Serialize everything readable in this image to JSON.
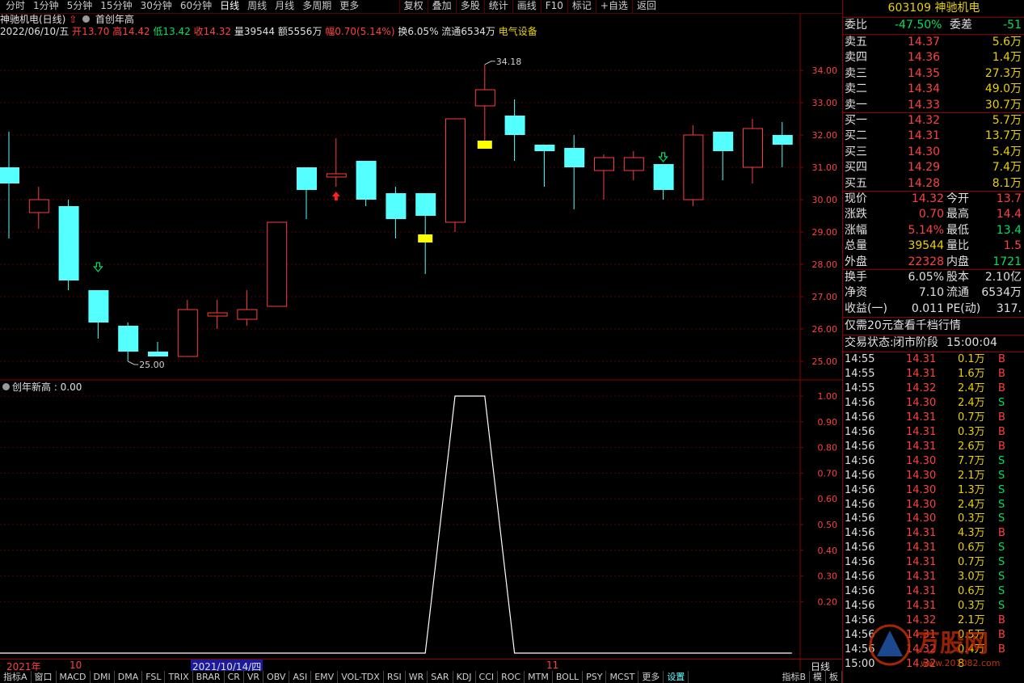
{
  "toolbar": {
    "periods": [
      "分时",
      "1分钟",
      "5分钟",
      "15分钟",
      "30分钟",
      "60分钟",
      "日线",
      "周线",
      "月线",
      "多周期",
      "更多"
    ],
    "active_period": "日线",
    "right_buttons": [
      "复权",
      "叠加",
      "多股",
      "统计",
      "画线",
      "F10",
      "标记",
      "+自选",
      "返回"
    ]
  },
  "header": {
    "title": "神驰机电(日线)",
    "indicator_name": "首创年高",
    "date": "2022/06/10/五",
    "open_label": "开",
    "open": "13.70",
    "high_label": "高",
    "high": "14.42",
    "low_label": "低",
    "low": "13.42",
    "close_label": "收",
    "close": "14.32",
    "vol_label": "量",
    "vol": "39544",
    "amount_label": "额",
    "amount": "5556万",
    "range_label": "幅",
    "range": "0.70(5.14%)",
    "turnover_label": "换",
    "turnover": "6.05%",
    "float_label": "流通",
    "float": "6534万",
    "sector": "电气设备"
  },
  "lower_header": {
    "label": "创年新高 : 0.00"
  },
  "colors": {
    "up": "#ff3c3c",
    "down": "#54ffff",
    "grid": "#5a0000",
    "axis": "#8a0000",
    "signal": "#ffff00",
    "marker_up": "#ff2020",
    "marker_down": "#00e060"
  },
  "chart_data": [
    {
      "type": "candlestick",
      "title": "神驰机电(日线)",
      "ylim": [
        24.5,
        35.0
      ],
      "y_ticks": [
        "34.00",
        "33.00",
        "32.00",
        "31.00",
        "30.00",
        "29.00",
        "28.00",
        "27.00",
        "26.00",
        "25.00"
      ],
      "y_tick_values": [
        34,
        33,
        32,
        31,
        30,
        29,
        28,
        27,
        26,
        25
      ],
      "annotations": {
        "max_label": "34.18",
        "min_label": "25.00"
      },
      "candles": [
        {
          "o": 31.0,
          "h": 32.1,
          "l": 28.8,
          "c": 30.5
        },
        {
          "o": 29.6,
          "h": 30.4,
          "l": 29.1,
          "c": 30.0
        },
        {
          "o": 29.8,
          "h": 30.0,
          "l": 27.2,
          "c": 27.5
        },
        {
          "o": 27.2,
          "h": 27.2,
          "l": 25.7,
          "c": 26.2
        },
        {
          "o": 26.1,
          "h": 26.2,
          "l": 25.0,
          "c": 25.3
        },
        {
          "o": 25.3,
          "h": 25.6,
          "l": 25.15,
          "c": 25.15
        },
        {
          "o": 25.15,
          "h": 26.9,
          "l": 25.15,
          "c": 26.6
        },
        {
          "o": 26.4,
          "h": 26.9,
          "l": 26.0,
          "c": 26.5
        },
        {
          "o": 26.3,
          "h": 27.2,
          "l": 26.1,
          "c": 26.6
        },
        {
          "o": 26.7,
          "h": 29.3,
          "l": 26.7,
          "c": 29.3
        },
        {
          "o": 31.0,
          "h": 31.0,
          "l": 29.4,
          "c": 30.3
        },
        {
          "o": 30.7,
          "h": 31.9,
          "l": 30.4,
          "c": 30.8
        },
        {
          "o": 31.2,
          "h": 31.2,
          "l": 29.8,
          "c": 30.0
        },
        {
          "o": 30.2,
          "h": 30.4,
          "l": 28.8,
          "c": 29.4
        },
        {
          "o": 30.2,
          "h": 30.2,
          "l": 27.7,
          "c": 29.5
        },
        {
          "o": 29.3,
          "h": 32.5,
          "l": 29.0,
          "c": 32.5
        },
        {
          "o": 32.9,
          "h": 34.18,
          "l": 31.8,
          "c": 33.4
        },
        {
          "o": 32.6,
          "h": 33.1,
          "l": 31.2,
          "c": 32.0
        },
        {
          "o": 31.7,
          "h": 31.7,
          "l": 30.4,
          "c": 31.5
        },
        {
          "o": 31.6,
          "h": 32.0,
          "l": 29.7,
          "c": 31.0
        },
        {
          "o": 30.9,
          "h": 31.4,
          "l": 30.0,
          "c": 31.3
        },
        {
          "o": 30.9,
          "h": 31.5,
          "l": 30.6,
          "c": 31.3
        },
        {
          "o": 31.1,
          "h": 31.1,
          "l": 30.0,
          "c": 30.3
        },
        {
          "o": 30.0,
          "h": 32.3,
          "l": 29.8,
          "c": 32.0
        },
        {
          "o": 32.1,
          "h": 32.1,
          "l": 30.6,
          "c": 31.5
        },
        {
          "o": 31.0,
          "h": 32.5,
          "l": 30.5,
          "c": 32.2
        },
        {
          "o": 32.0,
          "h": 32.4,
          "l": 31.0,
          "c": 31.7
        }
      ],
      "signals_yellow": [
        {
          "index": 14,
          "price": 28.8
        },
        {
          "index": 16,
          "price": 31.7
        }
      ],
      "arrows_red_up": [
        {
          "index": 11,
          "price": 30.1
        }
      ],
      "arrows_green_down": [
        {
          "index": 3,
          "price": 27.9
        },
        {
          "index": 22,
          "price": 31.3
        }
      ]
    },
    {
      "type": "line",
      "series": [
        {
          "name": "创年新高",
          "values": [
            0,
            0,
            0,
            0,
            0,
            0,
            0,
            0,
            0,
            0,
            0,
            0,
            0,
            0,
            0,
            1,
            1,
            0,
            0,
            0,
            0,
            0,
            0,
            0,
            0,
            0,
            0
          ]
        }
      ],
      "ylim": [
        0,
        1.0
      ],
      "y_ticks": [
        "1.00",
        "0.90",
        "0.80",
        "0.70",
        "0.60",
        "0.50",
        "0.40",
        "0.30",
        "0.20"
      ],
      "y_tick_values": [
        1.0,
        0.9,
        0.8,
        0.7,
        0.6,
        0.5,
        0.4,
        0.3,
        0.2
      ]
    }
  ],
  "date_bar": {
    "labels": [
      "2021年",
      "10",
      "2021/10/14/四",
      "11"
    ],
    "right_label": "日线"
  },
  "bottom_tabs": [
    "指标A",
    "窗口",
    "MACD",
    "DMI",
    "DMA",
    "FSL",
    "TRIX",
    "BRAR",
    "CR",
    "VR",
    "OBV",
    "ASI",
    "EMV",
    "VOL-TDX",
    "RSI",
    "WR",
    "SAR",
    "KDJ",
    "CCI",
    "ROC",
    "MTM",
    "BOLL",
    "PSY",
    "MCST",
    "更多",
    "设置",
    "指标B",
    "模",
    "板"
  ],
  "bottom_tabs_selected": "设置",
  "panel": {
    "code": "603109",
    "name": "神驰机电",
    "weibi_label": "委比",
    "weibi": "-47.50%",
    "weicha_label": "委差",
    "weicha": "-51",
    "sells": [
      {
        "label": "卖五",
        "price": "14.37",
        "vol": "5.6万"
      },
      {
        "label": "卖四",
        "price": "14.36",
        "vol": "1.4万"
      },
      {
        "label": "卖三",
        "price": "14.35",
        "vol": "27.3万"
      },
      {
        "label": "卖二",
        "price": "14.34",
        "vol": "49.0万"
      },
      {
        "label": "卖一",
        "price": "14.33",
        "vol": "30.7万"
      }
    ],
    "buys": [
      {
        "label": "买一",
        "price": "14.32",
        "vol": "5.7万"
      },
      {
        "label": "买二",
        "price": "14.31",
        "vol": "13.7万"
      },
      {
        "label": "买三",
        "price": "14.30",
        "vol": "5.4万"
      },
      {
        "label": "买四",
        "price": "14.29",
        "vol": "7.4万"
      },
      {
        "label": "买五",
        "price": "14.28",
        "vol": "8.1万"
      }
    ],
    "stats": [
      {
        "l1": "现价",
        "v1": "14.32",
        "l2": "今开",
        "v2": "13.7"
      },
      {
        "l1": "涨跌",
        "v1": "0.70",
        "l2": "最高",
        "v2": "14.4"
      },
      {
        "l1": "涨幅",
        "v1": "5.14%",
        "l2": "最低",
        "v2": "13.4"
      },
      {
        "l1": "总量",
        "v1": "39544",
        "l2": "量比",
        "v2": "1.5"
      },
      {
        "l1": "外盘",
        "v1": "22328",
        "l2": "内盘",
        "v2": "1721"
      }
    ],
    "stats2": [
      {
        "l1": "换手",
        "v1": "6.05%",
        "l2": "股本",
        "v2": "2.10亿"
      },
      {
        "l1": "净资",
        "v1": "7.10",
        "l2": "流通",
        "v2": "6534万"
      },
      {
        "l1": "收益(一)",
        "v1": "0.011",
        "l2": "PE(动)",
        "v2": "317."
      }
    ],
    "promo": "仅需20元查看千档行情",
    "trade_status_label": "交易状态:",
    "trade_status": "闭市阶段",
    "trade_time": "15:00:04",
    "ticks": [
      {
        "t": "14:55",
        "p": "14.31",
        "v": "0.1万",
        "s": "B"
      },
      {
        "t": "14:55",
        "p": "14.31",
        "v": "1.6万",
        "s": "B"
      },
      {
        "t": "14:55",
        "p": "14.32",
        "v": "2.4万",
        "s": "B"
      },
      {
        "t": "14:56",
        "p": "14.30",
        "v": "2.4万",
        "s": "S"
      },
      {
        "t": "14:56",
        "p": "14.31",
        "v": "0.7万",
        "s": "B"
      },
      {
        "t": "14:56",
        "p": "14.31",
        "v": "0.3万",
        "s": "B"
      },
      {
        "t": "14:56",
        "p": "14.31",
        "v": "2.6万",
        "s": "B"
      },
      {
        "t": "14:56",
        "p": "14.30",
        "v": "7.7万",
        "s": "S"
      },
      {
        "t": "14:56",
        "p": "14.30",
        "v": "2.1万",
        "s": "S"
      },
      {
        "t": "14:56",
        "p": "14.30",
        "v": "1.3万",
        "s": "S"
      },
      {
        "t": "14:56",
        "p": "14.30",
        "v": "2.4万",
        "s": "S"
      },
      {
        "t": "14:56",
        "p": "14.30",
        "v": "0.3万",
        "s": "S"
      },
      {
        "t": "14:56",
        "p": "14.31",
        "v": "4.3万",
        "s": "B"
      },
      {
        "t": "14:56",
        "p": "14.31",
        "v": "0.6万",
        "s": "S"
      },
      {
        "t": "14:56",
        "p": "14.31",
        "v": "0.7万",
        "s": "S"
      },
      {
        "t": "14:56",
        "p": "14.31",
        "v": "3.0万",
        "s": "S"
      },
      {
        "t": "14:56",
        "p": "14.31",
        "v": "0.6万",
        "s": "S"
      },
      {
        "t": "14:56",
        "p": "14.31",
        "v": "0.3万",
        "s": "S"
      },
      {
        "t": "14:56",
        "p": "14.32",
        "v": "2.1万",
        "s": "B"
      },
      {
        "t": "14:56",
        "p": "14.31",
        "v": "0.5万",
        "s": "B"
      },
      {
        "t": "14:56",
        "p": "14.32",
        "v": "0.4万",
        "s": "B"
      },
      {
        "t": "15:00",
        "p": "14.32",
        "v": "8",
        "s": ""
      }
    ],
    "watermark": "www.201082.com"
  }
}
